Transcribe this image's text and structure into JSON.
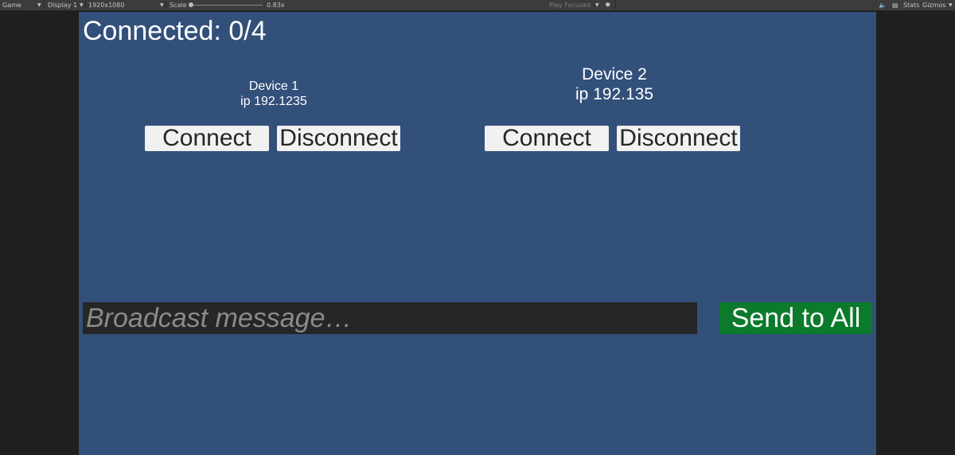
{
  "toolbar": {
    "view": "Game",
    "display": "Display 1",
    "resolution": "1920x1080",
    "scale_label": "Scale",
    "scale_value": "0.83x",
    "play_mode": "Play Focused",
    "stats": "Stats",
    "gizmos": "Gizmos"
  },
  "game": {
    "connected_label": "Connected: 0/4",
    "devices": [
      {
        "name": "Device 1",
        "ip": "ip 192.1235",
        "connect": "Connect",
        "disconnect": "Disconnect"
      },
      {
        "name": "Device 2",
        "ip": "ip 192.135",
        "connect": "Connect",
        "disconnect": "Disconnect"
      }
    ],
    "broadcast_placeholder": "Broadcast message…",
    "send_label": "Send to All"
  },
  "colors": {
    "background": "#32507a",
    "send_button": "#0b7a2b",
    "input_background": "#262626"
  }
}
